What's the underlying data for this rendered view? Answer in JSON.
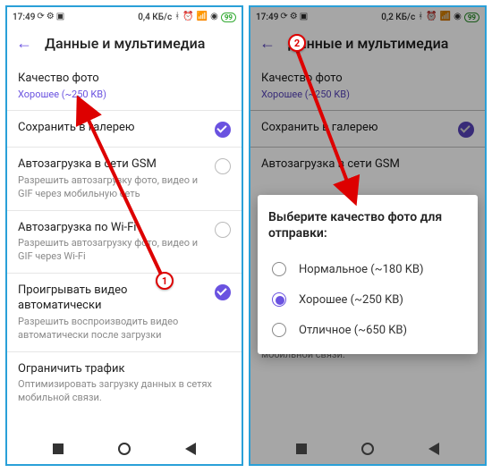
{
  "statusbar": {
    "time": "17:49",
    "speed1": "0,4 КБ/с",
    "speed2": "0,2 КБ/с",
    "battery": "99"
  },
  "header": {
    "title": "Данные и мультимедиа"
  },
  "settings": {
    "photo_quality": {
      "title": "Качество фото",
      "sub": "Хорошее (~250 KB)"
    },
    "save_gallery": {
      "title": "Сохранить в галерею"
    },
    "autoload_gsm": {
      "title": "Автозагрузка в сети GSM",
      "sub": "Разрешить автозагрузку фото, видео и GIF через мобильную сеть"
    },
    "autoload_wifi": {
      "title": "Автозагрузка по Wi-Fi",
      "sub": "Разрешить автозагрузку фото, видео и GIF через Wi-Fi"
    },
    "autoplay": {
      "title": "Проигрывать видео автоматически",
      "sub": "Разрешить воспроизводить видео автоматически после загрузки"
    },
    "limit_traffic": {
      "title": "Ограничить трафик",
      "sub": "Оптимизировать загрузку данных в сетях мобильной связи."
    }
  },
  "dialog": {
    "title": "Выберите качество фото для отправки:",
    "options": [
      {
        "label": "Нормальное (~180 KB)",
        "selected": false
      },
      {
        "label": "Хорошее (~250 KB)",
        "selected": true
      },
      {
        "label": "Отличное (~650 KB)",
        "selected": false
      }
    ]
  },
  "markers": {
    "m1": "1",
    "m2": "2"
  }
}
